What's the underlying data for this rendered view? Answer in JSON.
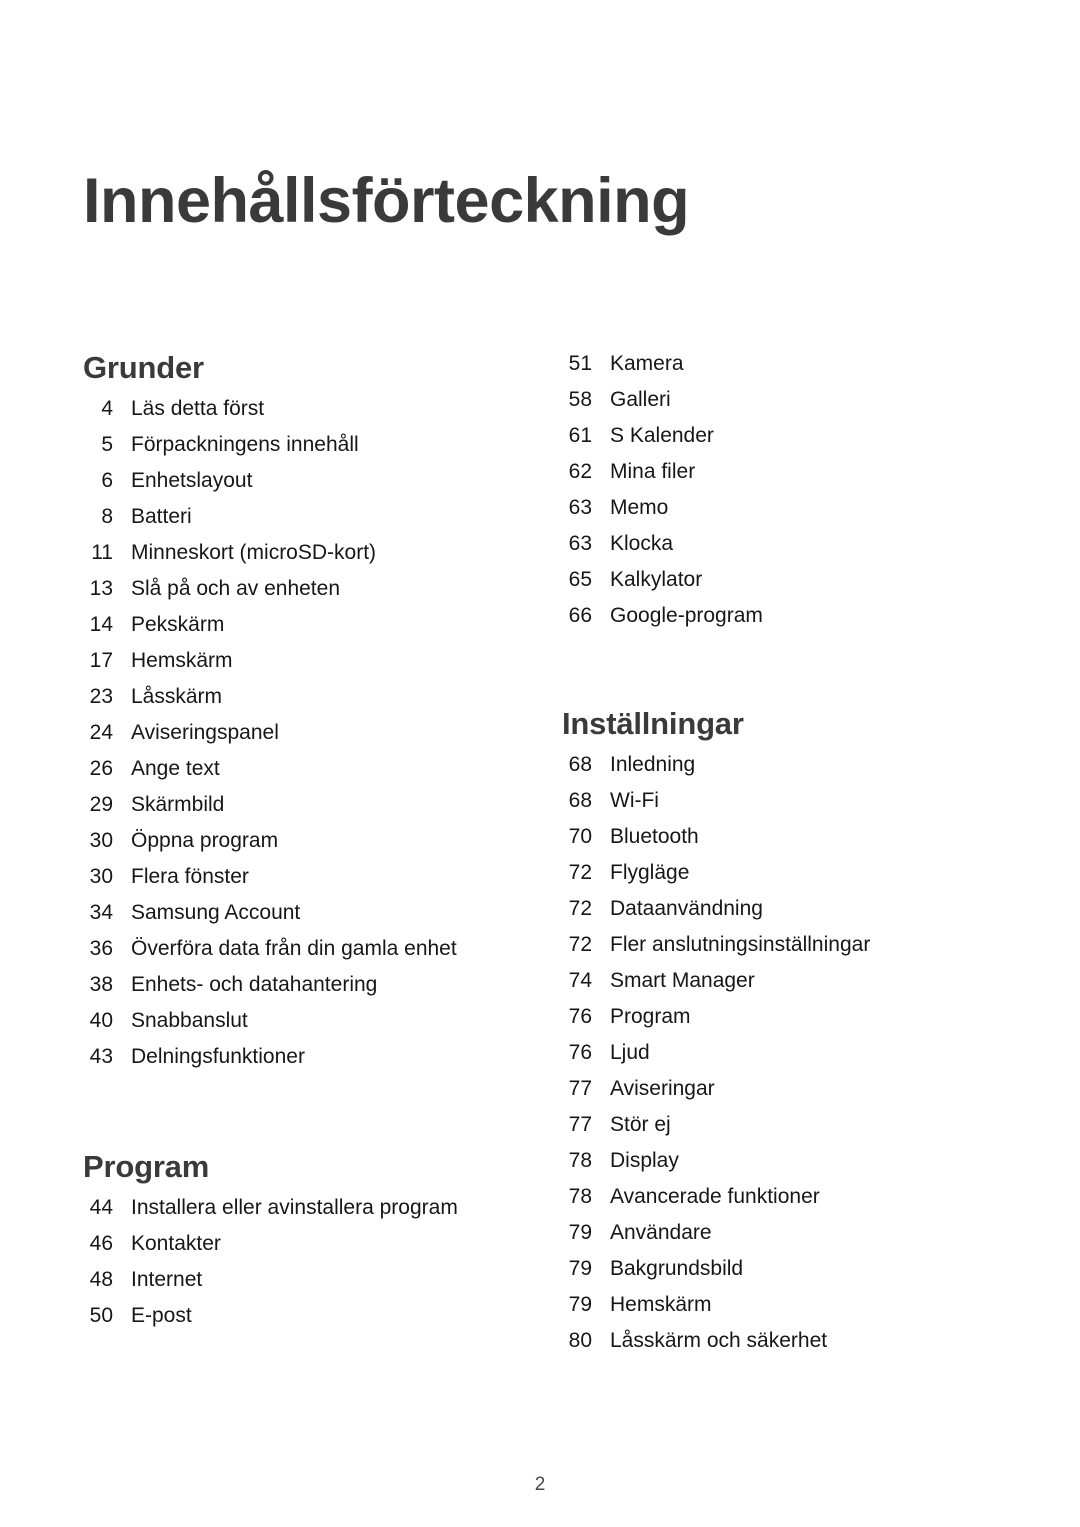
{
  "document": {
    "title": "Innehållsförteckning",
    "page_number": "2"
  },
  "left_column": {
    "sections": [
      {
        "heading": "Grunder",
        "entries": [
          {
            "page": "4",
            "label": "Läs detta först"
          },
          {
            "page": "5",
            "label": "Förpackningens innehåll"
          },
          {
            "page": "6",
            "label": "Enhetslayout"
          },
          {
            "page": "8",
            "label": "Batteri"
          },
          {
            "page": "11",
            "label": "Minneskort (microSD-kort)"
          },
          {
            "page": "13",
            "label": "Slå på och av enheten"
          },
          {
            "page": "14",
            "label": "Pekskärm"
          },
          {
            "page": "17",
            "label": "Hemskärm"
          },
          {
            "page": "23",
            "label": "Låsskärm"
          },
          {
            "page": "24",
            "label": "Aviseringspanel"
          },
          {
            "page": "26",
            "label": "Ange text"
          },
          {
            "page": "29",
            "label": "Skärmbild"
          },
          {
            "page": "30",
            "label": "Öppna program"
          },
          {
            "page": "30",
            "label": "Flera fönster"
          },
          {
            "page": "34",
            "label": "Samsung Account"
          },
          {
            "page": "36",
            "label": "Överföra data från din gamla enhet"
          },
          {
            "page": "38",
            "label": "Enhets- och datahantering"
          },
          {
            "page": "40",
            "label": "Snabbanslut"
          },
          {
            "page": "43",
            "label": "Delningsfunktioner"
          }
        ]
      },
      {
        "heading": "Program",
        "entries": [
          {
            "page": "44",
            "label": "Installera eller avinstallera program"
          },
          {
            "page": "46",
            "label": "Kontakter"
          },
          {
            "page": "48",
            "label": "Internet"
          },
          {
            "page": "50",
            "label": "E-post"
          }
        ]
      }
    ]
  },
  "right_column": {
    "sections": [
      {
        "heading": "",
        "entries": [
          {
            "page": "51",
            "label": "Kamera"
          },
          {
            "page": "58",
            "label": "Galleri"
          },
          {
            "page": "61",
            "label": "S Kalender"
          },
          {
            "page": "62",
            "label": "Mina filer"
          },
          {
            "page": "63",
            "label": "Memo"
          },
          {
            "page": "63",
            "label": "Klocka"
          },
          {
            "page": "65",
            "label": "Kalkylator"
          },
          {
            "page": "66",
            "label": "Google-program"
          }
        ]
      },
      {
        "heading": "Inställningar",
        "entries": [
          {
            "page": "68",
            "label": "Inledning"
          },
          {
            "page": "68",
            "label": "Wi-Fi"
          },
          {
            "page": "70",
            "label": "Bluetooth"
          },
          {
            "page": "72",
            "label": "Flygläge"
          },
          {
            "page": "72",
            "label": "Dataanvändning"
          },
          {
            "page": "72",
            "label": "Fler anslutningsinställningar"
          },
          {
            "page": "74",
            "label": "Smart Manager"
          },
          {
            "page": "76",
            "label": "Program"
          },
          {
            "page": "76",
            "label": "Ljud"
          },
          {
            "page": "77",
            "label": "Aviseringar"
          },
          {
            "page": "77",
            "label": "Stör ej"
          },
          {
            "page": "78",
            "label": "Display"
          },
          {
            "page": "78",
            "label": "Avancerade funktioner"
          },
          {
            "page": "79",
            "label": "Användare"
          },
          {
            "page": "79",
            "label": "Bakgrundsbild"
          },
          {
            "page": "79",
            "label": "Hemskärm"
          },
          {
            "page": "80",
            "label": "Låsskärm och säkerhet"
          }
        ]
      }
    ]
  },
  "colors": {
    "background": "#ffffff",
    "heading": "#3a3a3a",
    "body_text": "#171717",
    "folio": "#4a4a4a"
  }
}
